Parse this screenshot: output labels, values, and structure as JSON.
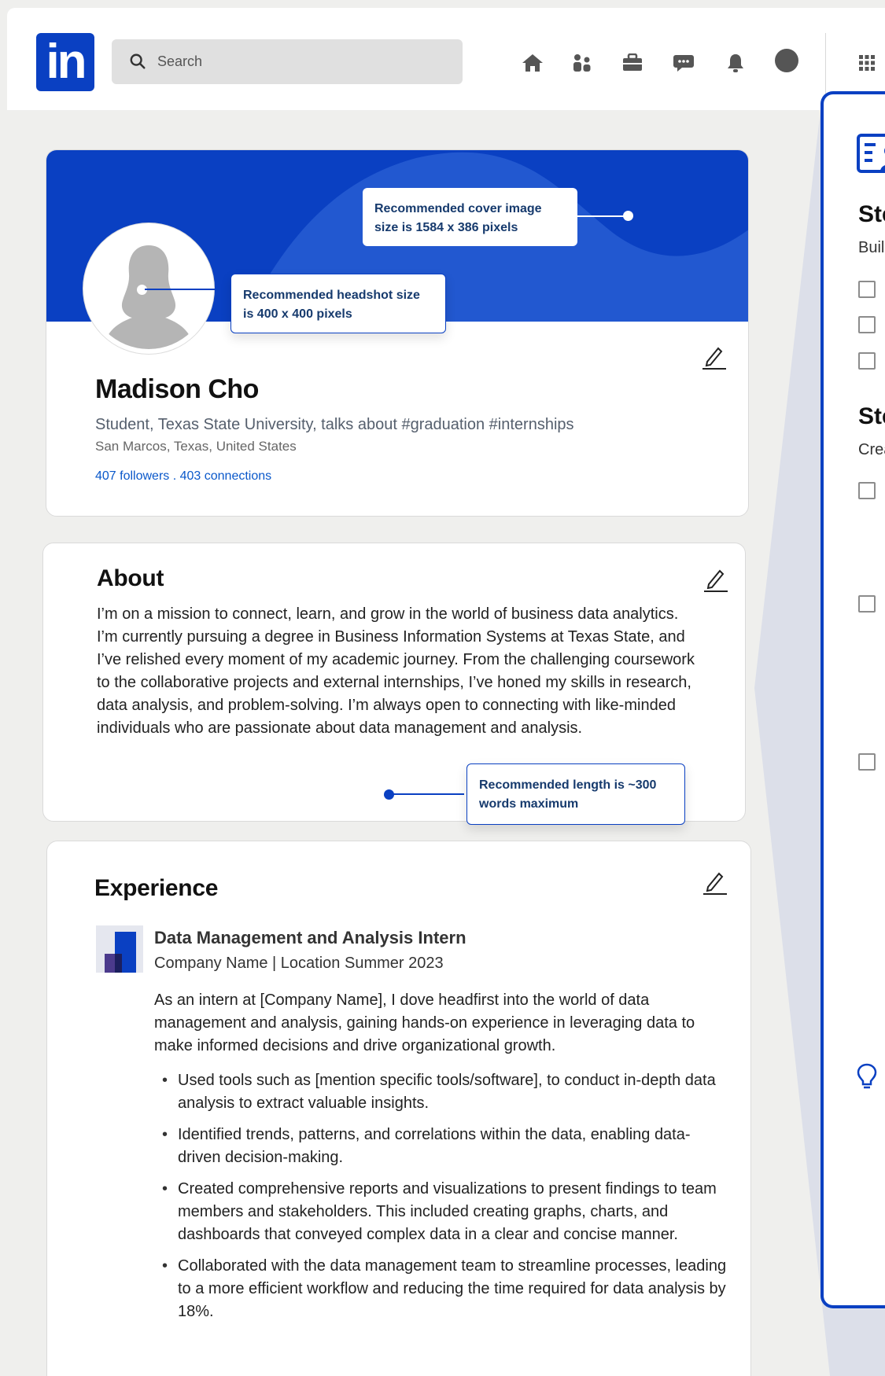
{
  "nav": {
    "logo_text": "in",
    "search_placeholder": "Search",
    "icons": [
      "home-icon",
      "network-icon",
      "jobs-icon",
      "messaging-icon",
      "notifications-icon",
      "profile-avatar",
      "apps-grid-icon"
    ]
  },
  "profile": {
    "name": "Madison Cho",
    "headline": "Student, Texas State University, talks about #graduation #internships",
    "location": "San Marcos, Texas, United States",
    "connections": "407 followers . 403 connections",
    "cover_callout": "Recommended cover image size is 1584 x 386 pixels",
    "headshot_callout": "Recommended headshot size is 400 x 400 pixels"
  },
  "about": {
    "title": "About",
    "text": "I’m on a mission to connect, learn, and grow in the world of business data analytics. I’m currently pursuing a degree in Business Information Systems at Texas State, and I’ve relished every moment of my academic journey. From the challenging coursework to the collaborative projects and external internships, I’ve honed my skills in research, data analysis, and problem-solving. I’m always open to connecting with like-minded individuals who are passionate about data management and analysis.",
    "callout": "Recommended length is ~300 words maximum"
  },
  "experience": {
    "title": "Experience",
    "job_title": "Data Management and Analysis Intern",
    "job_meta": "Company Name | Location  Summer 2023",
    "description": "As an intern at [Company Name], I dove headfirst into the world of data management and analysis, gaining hands-on experience in leveraging data to make informed decisions and drive organizational growth.",
    "bullets": [
      "Used tools such as [mention specific tools/software], to conduct in-depth data analysis to extract valuable insights.",
      "Identified trends, patterns, and correlations within the data, enabling data-driven decision-making.",
      "Created comprehensive reports and visualizations to present findings to team members and stakeholders. This included creating graphs, charts, and dashboards that conveyed complex data in a clear and concise manner.",
      "Collaborated with the data management team to streamline processes, leading to a more efficient workflow and reducing the time required for data analysis by 18%."
    ]
  },
  "right_panel": {
    "step1_heading": "Ste",
    "step1_sub": "Buil",
    "step2_heading": "Ste",
    "step2_sub": "Crea"
  },
  "colors": {
    "brand": "#0a40c2",
    "cover_light": "#1f5fcf",
    "link": "#0a58ca",
    "callout_text": "#163a6d"
  }
}
